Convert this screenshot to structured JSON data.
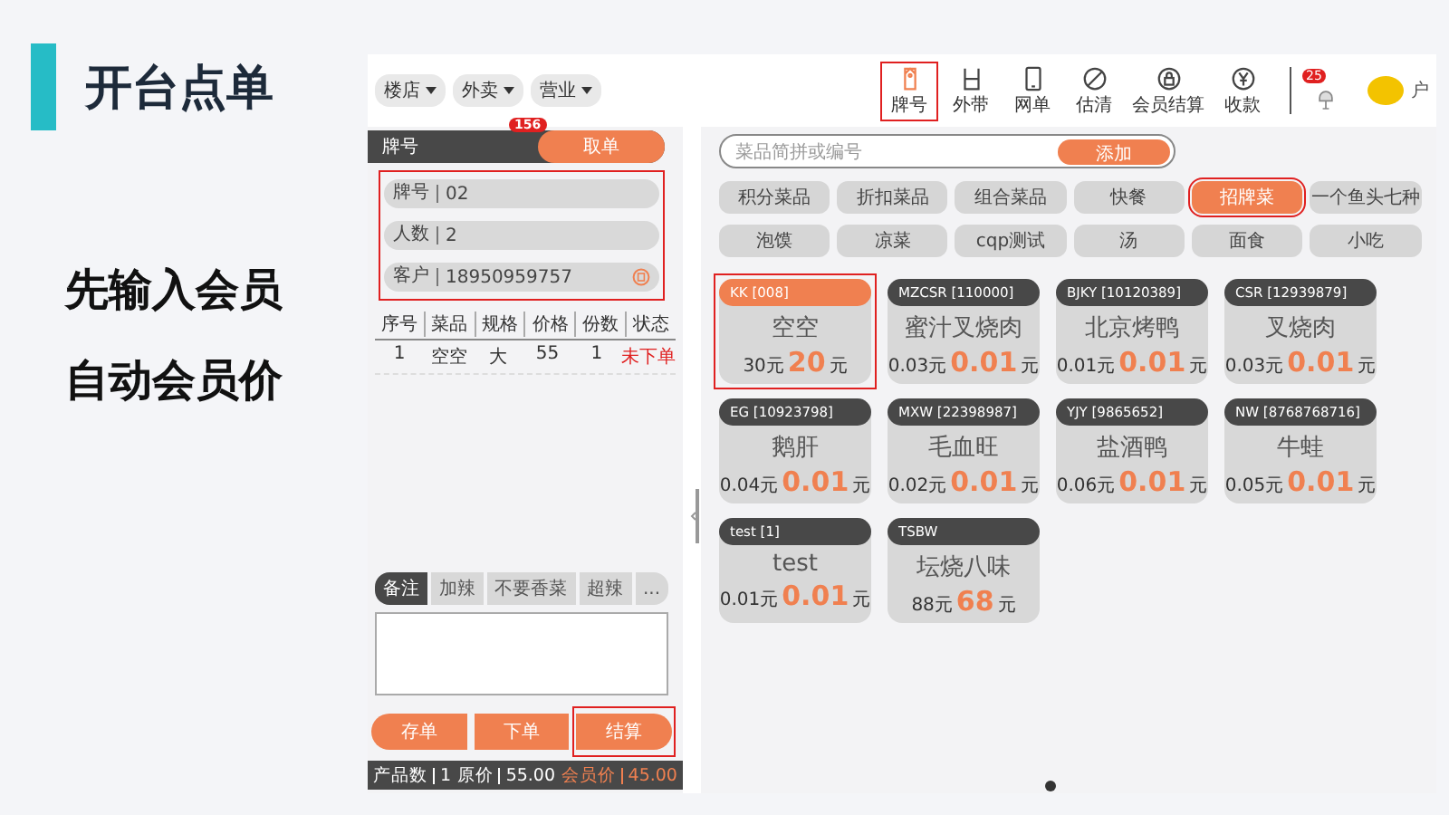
{
  "slide": {
    "title": "开台点单",
    "captions": [
      "先输入会员",
      "自动会员价"
    ]
  },
  "topbar": {
    "dropdowns": [
      "楼店",
      "外卖",
      "营业"
    ],
    "tools": [
      {
        "label": "牌号",
        "highlighted": true
      },
      {
        "label": "外带",
        "highlighted": false
      },
      {
        "label": "网单",
        "highlighted": false
      },
      {
        "label": "估清",
        "highlighted": false
      },
      {
        "label": "会员结算",
        "highlighted": false
      },
      {
        "label": "收款",
        "highlighted": false
      }
    ],
    "notification_badge": "25",
    "user_name": "户"
  },
  "order_panel": {
    "header_label": "牌号",
    "take_order_button": "取单",
    "take_order_badge": "156",
    "form": {
      "highlighted": true,
      "fields": [
        {
          "label": "牌号",
          "value": "02",
          "kind": "text"
        },
        {
          "label": "人数",
          "value": "2",
          "kind": "text"
        },
        {
          "label": "客户",
          "value": "18950959757",
          "kind": "member"
        }
      ]
    },
    "table": {
      "columns": [
        "序号",
        "菜品",
        "规格",
        "价格",
        "份数",
        "状态"
      ],
      "rows": [
        {
          "cells": [
            "1",
            "空空",
            "大",
            "55",
            "1",
            "未下单"
          ],
          "sent": false
        }
      ]
    },
    "remark_tabs": [
      {
        "label": "备注",
        "selected": true
      },
      {
        "label": "加辣",
        "selected": false
      },
      {
        "label": "不要香菜",
        "selected": false
      },
      {
        "label": "超辣",
        "selected": false
      },
      {
        "label": "...",
        "selected": false
      }
    ],
    "buttons": [
      {
        "label": "存单",
        "highlighted": false
      },
      {
        "label": "下单",
        "highlighted": false
      },
      {
        "label": "结算",
        "highlighted": true
      }
    ],
    "summary": [
      {
        "label": "产品数",
        "value": "1",
        "kind": "plain"
      },
      {
        "label": "原价",
        "value": "55.00",
        "kind": "plain"
      },
      {
        "label": "会员价",
        "value": "45.00",
        "kind": "member"
      }
    ]
  },
  "menu_panel": {
    "search": {
      "placeholder": "菜品简拼或编号"
    },
    "add_button": "添加",
    "categories": [
      {
        "label": "积分菜品",
        "selected": false
      },
      {
        "label": "折扣菜品",
        "selected": false
      },
      {
        "label": "组合菜品",
        "selected": false
      },
      {
        "label": "快餐",
        "selected": false
      },
      {
        "label": "招牌菜",
        "selected": true
      },
      {
        "label": "一个鱼头七种",
        "selected": false
      },
      {
        "label": "泡馍",
        "selected": false
      },
      {
        "label": "凉菜",
        "selected": false
      },
      {
        "label": "cqp测试",
        "selected": false
      },
      {
        "label": "汤",
        "selected": false
      },
      {
        "label": "面食",
        "selected": false
      },
      {
        "label": "小吃",
        "selected": false
      }
    ],
    "dishes": [
      {
        "code": "KK [008]",
        "name": "空空",
        "price": "30元",
        "member_price": "20",
        "unit": "元",
        "selected": true
      },
      {
        "code": "MZCSR [110000]",
        "name": "蜜汁叉烧肉",
        "price": "0.03元",
        "member_price": "0.01",
        "unit": "元",
        "selected": false
      },
      {
        "code": "BJKY [10120389]",
        "name": "北京烤鸭",
        "price": "0.01元",
        "member_price": "0.01",
        "unit": "元",
        "selected": false
      },
      {
        "code": "CSR [12939879]",
        "name": "叉烧肉",
        "price": "0.03元",
        "member_price": "0.01",
        "unit": "元",
        "selected": false
      },
      {
        "code": "EG [10923798]",
        "name": "鹅肝",
        "price": "0.04元",
        "member_price": "0.01",
        "unit": "元",
        "selected": false
      },
      {
        "code": "MXW [22398987]",
        "name": "毛血旺",
        "price": "0.02元",
        "member_price": "0.01",
        "unit": "元",
        "selected": false
      },
      {
        "code": "YJY [9865652]",
        "name": "盐酒鸭",
        "price": "0.06元",
        "member_price": "0.01",
        "unit": "元",
        "selected": false
      },
      {
        "code": "NW [8768768716]",
        "name": "牛蛙",
        "price": "0.05元",
        "member_price": "0.01",
        "unit": "元",
        "selected": false
      },
      {
        "code": "test [1]",
        "name": "test",
        "price": "0.01元",
        "member_price": "0.01",
        "unit": "元",
        "selected": false
      },
      {
        "code": "TSBW",
        "name": "坛烧八味",
        "price": "88元",
        "member_price": "68",
        "unit": "元",
        "selected": false
      }
    ]
  }
}
